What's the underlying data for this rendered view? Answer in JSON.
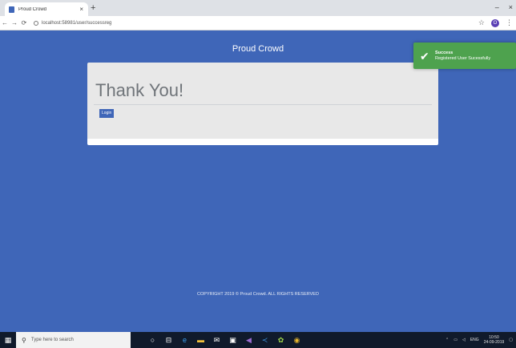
{
  "browser": {
    "tab_title": "Proud Crowd",
    "tab_close": "×",
    "new_tab": "+",
    "address": "localhost:58981/user/successreg",
    "win_minimize": "–",
    "win_close": "×",
    "avatar_letter": "O"
  },
  "page": {
    "brand": "Proud Crowd",
    "heading": "Thank You!",
    "login_label": "Login",
    "footer": "COPYRIGHT 2019 © Proud Crowd. ALL RIGHTS RESERVED"
  },
  "toast": {
    "title": "Success",
    "message": "Registered User Sucessfully",
    "color": "#4ea24e"
  },
  "taskbar": {
    "search_placeholder": "Type here to search",
    "time": "10:50",
    "date": "24-09-2019",
    "language": "ENG"
  },
  "colors": {
    "page_bg": "#3f66b8",
    "card_bg": "#e8e8e8",
    "button_bg": "#3f66b8"
  }
}
